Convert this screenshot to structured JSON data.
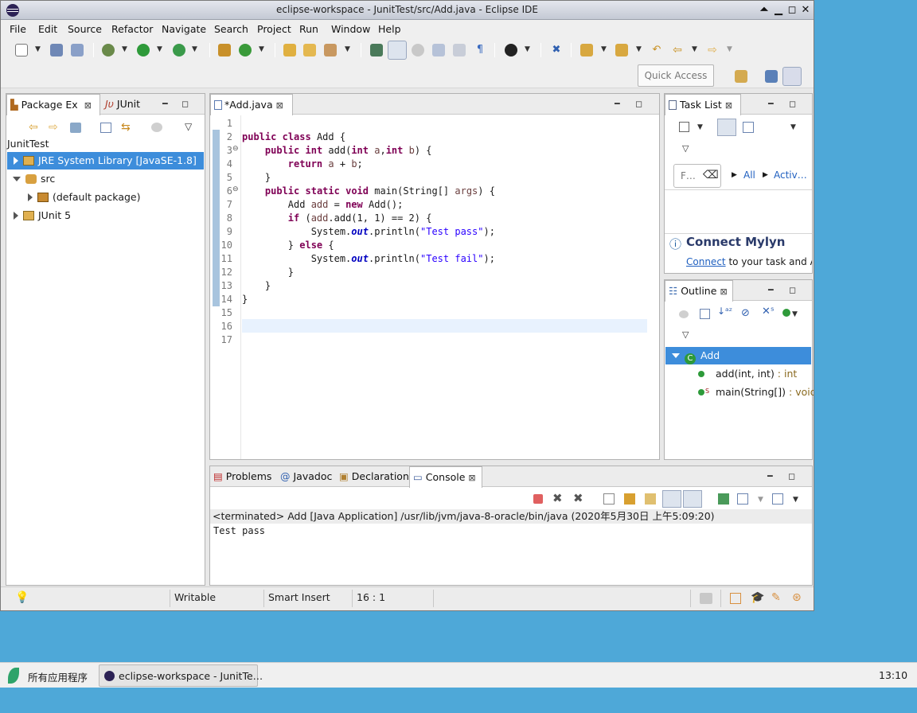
{
  "window": {
    "title": "eclipse-workspace - JunitTest/src/Add.java - Eclipse IDE"
  },
  "menu": [
    "File",
    "Edit",
    "Source",
    "Refactor",
    "Navigate",
    "Search",
    "Project",
    "Run",
    "Window",
    "Help"
  ],
  "toolbar": {
    "quick_access_placeholder": "Quick Access"
  },
  "left_panel": {
    "tabs": [
      {
        "label": "Package Ex",
        "icon": "package-explorer-icon"
      },
      {
        "label": "JUnit",
        "icon": "junit-icon"
      }
    ],
    "project": "JunitTest",
    "tree": [
      {
        "label": "JRE System Library [JavaSE-1.8]",
        "icon": "library-icon",
        "expanded": false,
        "selected": true
      },
      {
        "label": "src",
        "icon": "source-folder-icon",
        "expanded": true
      },
      {
        "label": "(default package)",
        "icon": "package-icon",
        "expanded": false
      },
      {
        "label": "JUnit 5",
        "icon": "library-icon",
        "expanded": false
      }
    ]
  },
  "editor": {
    "tab_label": "*Add.java",
    "line_numbers": [
      "1",
      "2",
      "3",
      "4",
      "5",
      "6",
      "7",
      "8",
      "9",
      "10",
      "11",
      "12",
      "13",
      "14",
      "15",
      "16",
      "17"
    ],
    "current_line": 16
  },
  "task_list": {
    "tab_label": "Task List",
    "filter_placeholder": "F…",
    "links": [
      "All",
      "Activ…"
    ],
    "connect_title": "Connect Mylyn",
    "connect_link": "Connect",
    "connect_text": " to your task and AL"
  },
  "outline": {
    "tab_label": "Outline",
    "class_name": "Add",
    "members": [
      {
        "name": "add(int, int)",
        "type": " : int",
        "static": false
      },
      {
        "name": "main(String[])",
        "type": " : void",
        "static": true
      }
    ]
  },
  "bottom": {
    "tabs": [
      "Problems",
      "Javadoc",
      "Declaration",
      "Console"
    ],
    "active_tab": "Console",
    "console_header": "<terminated> Add [Java Application] /usr/lib/jvm/java-8-oracle/bin/java (2020年5月30日 上午5:09:20)",
    "console_output": "Test pass"
  },
  "status": {
    "mode": "Writable",
    "insert": "Smart Insert",
    "position": "16 : 1"
  },
  "taskbar": {
    "apps_label": "所有应用程序",
    "window_label": "eclipse-workspace - JunitTe…",
    "clock": "13:10"
  },
  "colors": {
    "selection": "#3d8ddb",
    "keyword": "#7f0055",
    "string": "#2a00ff",
    "field": "#0000c0",
    "desktop": "#4ea8d8"
  }
}
